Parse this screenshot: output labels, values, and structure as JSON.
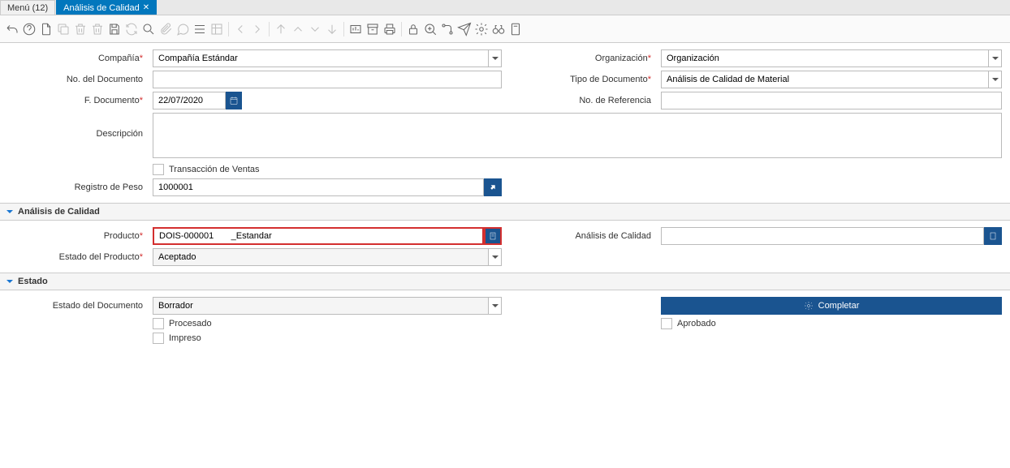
{
  "tabs": {
    "menu": "Menú (12)",
    "active": "Análisis de Calidad"
  },
  "form": {
    "compania_label": "Compañía",
    "compania_value": "Compañía Estándar",
    "organizacion_label": "Organización",
    "organizacion_value": "Organización",
    "nodoc_label": "No. del Documento",
    "nodoc_value": "",
    "tipodoc_label": "Tipo de Documento",
    "tipodoc_value": "Análisis de Calidad de Material",
    "fdoc_label": "F. Documento",
    "fdoc_value": "22/07/2020",
    "noref_label": "No. de Referencia",
    "noref_value": "",
    "descripcion_label": "Descripción",
    "descripcion_value": "",
    "transventas_label": "Transacción de Ventas",
    "regpeso_label": "Registro de Peso",
    "regpeso_value": "1000001"
  },
  "analisis": {
    "header": "Análisis de Calidad",
    "producto_label": "Producto",
    "producto_value": "DOIS-000001       _Estandar",
    "acalidad_label": "Análisis de Calidad",
    "acalidad_value": "",
    "estadoprod_label": "Estado del Producto",
    "estadoprod_value": "Aceptado"
  },
  "estado": {
    "header": "Estado",
    "estadodoc_label": "Estado del Documento",
    "estadodoc_value": "Borrador",
    "completar_label": "Completar",
    "procesado_label": "Procesado",
    "aprobado_label": "Aprobado",
    "impreso_label": "Impreso"
  }
}
